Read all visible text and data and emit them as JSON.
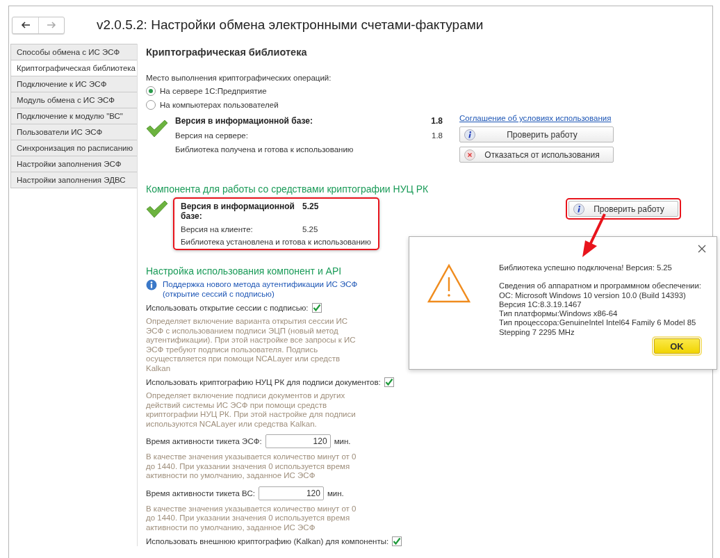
{
  "header": {
    "title": "v2.0.5.2: Настройки обмена электронными счетами-фактурами"
  },
  "sidebar": {
    "items": [
      {
        "label": "Способы обмена с ИС ЭСФ",
        "selected": false
      },
      {
        "label": "Криптографическая библиотека",
        "selected": true
      },
      {
        "label": "Подключение к ИС ЭСФ",
        "selected": false
      },
      {
        "label": "Модуль обмена с ИС ЭСФ",
        "selected": false
      },
      {
        "label": "Подключение к модулю \"ВС\"",
        "selected": false
      },
      {
        "label": "Пользователи ИС ЭСФ",
        "selected": false
      },
      {
        "label": "Синхронизация по расписанию",
        "selected": false
      },
      {
        "label": "Настройки заполнения ЭСФ",
        "selected": false
      },
      {
        "label": "Настройки заполнения ЭДВС",
        "selected": false
      }
    ]
  },
  "crypto_library": {
    "title": "Криптографическая библиотека",
    "location_label": "Место выполнения криптографических операций:",
    "options": [
      {
        "label": "На сервере 1С:Предприятие",
        "selected": true
      },
      {
        "label": "На компьютерах пользователей",
        "selected": false
      }
    ],
    "rows": [
      {
        "kind": "heading",
        "label": "Версия в информационной базе:",
        "value": "1.8"
      },
      {
        "kind": "row",
        "label": "Версия на сервере:",
        "value": "1.8"
      },
      {
        "kind": "note",
        "label": "Библиотека получена и готова к использованию"
      }
    ],
    "link": "Соглашение об условиях использования",
    "buttons": [
      {
        "kind": "info",
        "label": "Проверить работу"
      },
      {
        "kind": "cancel",
        "label": "Отказаться от использования"
      }
    ]
  },
  "component": {
    "title": "Компонента для работы со средствами криптографии НУЦ РК",
    "highlighted": true,
    "rows": [
      {
        "kind": "heading",
        "label": "Версия в информационной базе:",
        "value": "5.25"
      },
      {
        "kind": "row",
        "label": "Версия на клиенте:",
        "value": "5.25"
      },
      {
        "kind": "note",
        "label": "Библиотека установлена и готова к использованию"
      }
    ],
    "check_button": {
      "label": "Проверить работу",
      "highlighted": true
    }
  },
  "api_settings": {
    "title": "Настройка использования компонент и API",
    "info_link": "Поддержка нового метода аутентификации ИС ЭСФ (открытие сессий с подписью)",
    "items": [
      {
        "kind": "checkbox",
        "label": "Использовать открытие сессии с подписью:",
        "checked": true
      },
      {
        "kind": "note",
        "text": "Определяет включение варианта открытия сессии ИС ЭСФ с использованием подписи ЭЦП (новый метод аутентификации). При этой настройке все запросы к ИС ЭСФ требуют подписи пользователя. Подпись осуществляется при помощи NCALayer или средств Kalkan"
      },
      {
        "kind": "checkbox",
        "label": "Использовать криптографию НУЦ РК для подписи документов:",
        "checked": true
      },
      {
        "kind": "note",
        "text": "Определяет включение подписи документов и других действий системы ИС ЭСФ при помощи средств криптографии НУЦ РК. При этой настройке для подписи используются NCALayer или средства Kalkan."
      },
      {
        "kind": "number",
        "label": "Время активности тикета ЭСФ:",
        "value": "120",
        "unit": "мин."
      },
      {
        "kind": "note",
        "text": "В качестве значения указывается количество минут от 0 до 1440. При указании значения 0 используется время активности по умолчанию, заданное ИС ЭСФ"
      },
      {
        "kind": "number",
        "label": "Время активности тикета ВС:",
        "value": "120",
        "unit": "мин."
      },
      {
        "kind": "note",
        "text": "В качестве значения указывается количество минут от 0 до 1440. При указании значения 0 используется время активности по умолчанию, заданное ИС ЭСФ"
      },
      {
        "kind": "checkbox",
        "label": "Использовать внешнюю криптографию (Kalkan) для компоненты:",
        "checked": true
      }
    ]
  },
  "dialog": {
    "message": "Библиотека успешно подключена! Версия: 5.25",
    "details": [
      "Сведения об аппаратном и программном обеспечении:",
      "ОС: Microsoft Windows 10 version 10.0  (Build 14393)",
      "Версия 1С:8.3.19.1467",
      "Тип платформы:Windows x86-64",
      "Тип процессора:GenuineIntel Intel64 Family 6 Model 85",
      "Stepping 7 2295 MHz"
    ],
    "ok_button": "OK"
  }
}
